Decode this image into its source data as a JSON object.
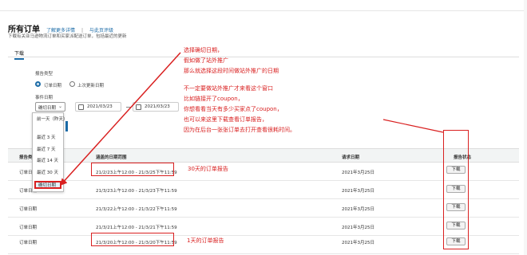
{
  "header": {
    "title": "所有订单",
    "link1": "了解更多详情",
    "sep": "|",
    "link2": "与此页评级"
  },
  "subtitle": "下载有关亚马逊物流订单和买家派配送订单，包括最近的更新",
  "tabs": [
    {
      "label": "下载"
    }
  ],
  "form": {
    "report_type_label": "报告类型",
    "radio_options": [
      "订单日期",
      "上次更新日期"
    ],
    "event_date_label": "事件日期",
    "range_select": "确切日期",
    "date_from": "2021/03/23",
    "date_to": "2021/03/23",
    "dropdown": [
      "前一天（昨天）",
      "最近 3 天",
      "最近 7 天",
      "最近 14 天",
      "最近 30 天",
      "确切日期"
    ]
  },
  "table": {
    "headers": [
      "报告类型",
      "涵盖的日期范围",
      "请求日期",
      "报告状态"
    ],
    "rows": [
      {
        "type": "订单日期",
        "range": "21/2/23上午12:00 - 21/3/25下午11:59",
        "req": "2021年3月25日",
        "btn": "下载"
      },
      {
        "type": "订单日期",
        "range": "21/3/23上午12:00 - 21/3/23下午11:59",
        "req": "2021年3月25日",
        "btn": "下载"
      },
      {
        "type": "订单日期",
        "range": "21/3/22上午12:00 - 21/3/22下午11:59",
        "req": "2021年3月25日",
        "btn": "下载"
      },
      {
        "type": "订单日期",
        "range": "21/3/21上午12:00 - 21/3/21下午11:59",
        "req": "2021年3月25日",
        "btn": "下载"
      },
      {
        "type": "订单日期",
        "range": "21/3/20上午12:00 - 21/3/20下午11:59",
        "req": "2021年3月25日",
        "btn": "下载"
      }
    ]
  },
  "annotations": {
    "note_lines": [
      "选择确切日期，",
      "假如做了站外推广",
      "那么就选择这段时间做站外推广的日期",
      "",
      "不一定要做站外推广才来看这个窗口",
      "比如链接开了coupon，",
      "你想看看当天有多少买家点了coupon，",
      "也可以来这里下载查看订单报告，",
      "因为在后台一张张订单去打开查看很耗时间。"
    ],
    "label30": "30天的订单报告",
    "label1": "1天的订单报告"
  },
  "colors": {
    "annotation": "#d92020",
    "accent": "#1a6aa6"
  }
}
